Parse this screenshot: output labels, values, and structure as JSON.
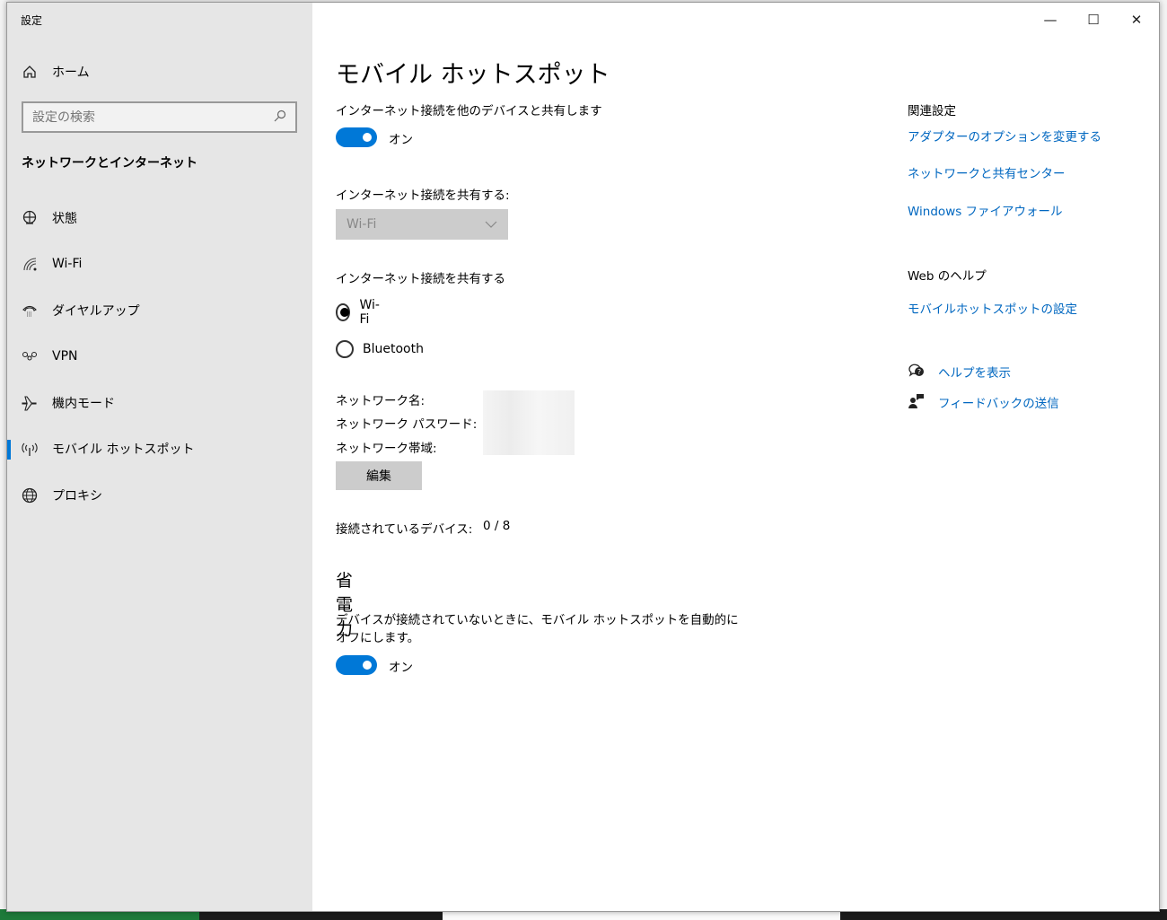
{
  "window": {
    "title": "設定",
    "minimize": "—",
    "maximize": "☐",
    "close": "✕"
  },
  "sidebar": {
    "home": "ホーム",
    "search_placeholder": "設定の検索",
    "category": "ネットワークとインターネット",
    "items": [
      {
        "label": "状態"
      },
      {
        "label": "Wi-Fi"
      },
      {
        "label": "ダイヤルアップ"
      },
      {
        "label": "VPN"
      },
      {
        "label": "機内モード"
      },
      {
        "label": "モバイル ホットスポット"
      },
      {
        "label": "プロキシ"
      }
    ]
  },
  "main": {
    "title": "モバイル ホットスポット",
    "share_label": "インターネット接続を他のデバイスと共有します",
    "share_toggle": "オン",
    "share_from_label": "インターネット接続を共有する:",
    "share_from_value": "Wi-Fi",
    "share_over_label": "インターネット接続を共有する",
    "radio_wifi": "Wi-Fi",
    "radio_bt": "Bluetooth",
    "network_name_label": "ネットワーク名:",
    "network_password_label": "ネットワーク パスワード:",
    "network_band_label": "ネットワーク帯域:",
    "edit_button": "編集",
    "devices_label": "接続されているデバイス:",
    "devices_value": "0 / 8",
    "power_heading": "省電力",
    "power_desc": "デバイスが接続されていないときに、モバイル ホットスポットを自動的にオフにします。",
    "power_toggle": "オン"
  },
  "related": {
    "heading": "関連設定",
    "links": [
      "アダプターのオプションを変更する",
      "ネットワークと共有センター",
      "Windows ファイアウォール"
    ],
    "web_help": "Web のヘルプ",
    "web_link": "モバイルホットスポットの設定",
    "get_help": "ヘルプを表示",
    "feedback": "フィードバックの送信"
  },
  "colors": {
    "accent": "#0078d7",
    "link": "#0067c0",
    "sidebar": "#e6e6e6"
  }
}
